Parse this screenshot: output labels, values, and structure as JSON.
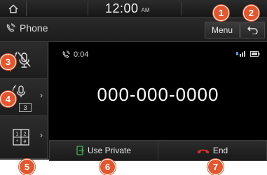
{
  "status_bar": {
    "time": "12:00",
    "ampm": "AM",
    "home_icon": "home-icon"
  },
  "title_bar": {
    "title": "Phone",
    "title_icon": "phone-call-icon",
    "menu_label": "Menu",
    "back_icon": "back-arrow-icon"
  },
  "sidebar": {
    "mute_icon": "mic-mute-icon",
    "mic_volume_icon": "mic-volume-icon",
    "mic_volume_level": "3",
    "keypad_icon": "keypad-icon"
  },
  "call": {
    "duration": "0:04",
    "number": "000-000-0000",
    "bluetooth_signal_icon": "signal-icon",
    "battery_icon": "battery-icon"
  },
  "actions": {
    "use_private_label": "Use Private",
    "end_label": "End"
  },
  "callouts": [
    "1",
    "2",
    "3",
    "4",
    "5",
    "6",
    "7"
  ],
  "colors": {
    "callout": "#e2572e",
    "end_icon": "#d9322a",
    "private_icon": "#3fb24f"
  }
}
